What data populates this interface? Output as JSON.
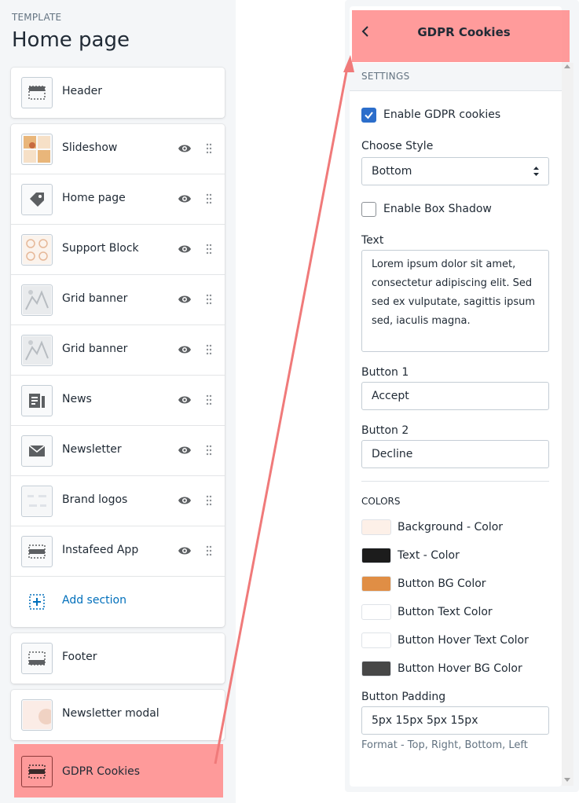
{
  "left": {
    "template_label": "TEMPLATE",
    "page_title": "Home page",
    "header_item": "Header",
    "sections": [
      {
        "label": "Slideshow",
        "icon": "slideshow-thumbnail"
      },
      {
        "label": "Home page",
        "icon": "tag-icon"
      },
      {
        "label": "Support Block",
        "icon": "support-thumbnail"
      },
      {
        "label": "Grid banner",
        "icon": "grid-banner-thumbnail"
      },
      {
        "label": "Grid banner",
        "icon": "grid-banner-thumbnail"
      },
      {
        "label": "News",
        "icon": "news-icon"
      },
      {
        "label": "Newsletter",
        "icon": "envelope-icon"
      },
      {
        "label": "Brand logos",
        "icon": "brand-logos-thumbnail"
      },
      {
        "label": "Instafeed App",
        "icon": "section-icon"
      }
    ],
    "add_section": "Add section",
    "footer_item": "Footer",
    "newsletter_modal": "Newsletter modal",
    "gdpr_item": "GDPR Cookies"
  },
  "right": {
    "title": "GDPR Cookies",
    "settings_label": "SETTINGS",
    "enable_gdpr": {
      "label": "Enable GDPR cookies",
      "checked": true
    },
    "choose_style": {
      "label": "Choose Style",
      "value": "Bottom"
    },
    "enable_shadow": {
      "label": "Enable Box Shadow",
      "checked": false
    },
    "text": {
      "label": "Text",
      "value": "Lorem ipsum dolor sit amet, consectetur adipiscing elit. Sed sed ex vulputate, sagittis ipsum sed, iaculis magna."
    },
    "button1": {
      "label": "Button 1",
      "value": "Accept"
    },
    "button2": {
      "label": "Button 2",
      "value": "Decline"
    },
    "colors_heading": "COLORS",
    "colors": [
      {
        "label": "Background - Color",
        "hex": "#fdf0e8"
      },
      {
        "label": "Text - Color",
        "hex": "#1c1c1c"
      },
      {
        "label": "Button BG Color",
        "hex": "#e08e45"
      },
      {
        "label": "Button Text Color",
        "hex": "#ffffff"
      },
      {
        "label": "Button Hover Text Color",
        "hex": "#ffffff"
      },
      {
        "label": "Button Hover BG Color",
        "hex": "#474747"
      }
    ],
    "button_padding": {
      "label": "Button Padding",
      "value": "5px 15px 5px 15px",
      "help": "Format - Top, Right, Bottom, Left"
    }
  },
  "highlight_color": "#ff8a8a",
  "accent_color": "#2c6ecb"
}
